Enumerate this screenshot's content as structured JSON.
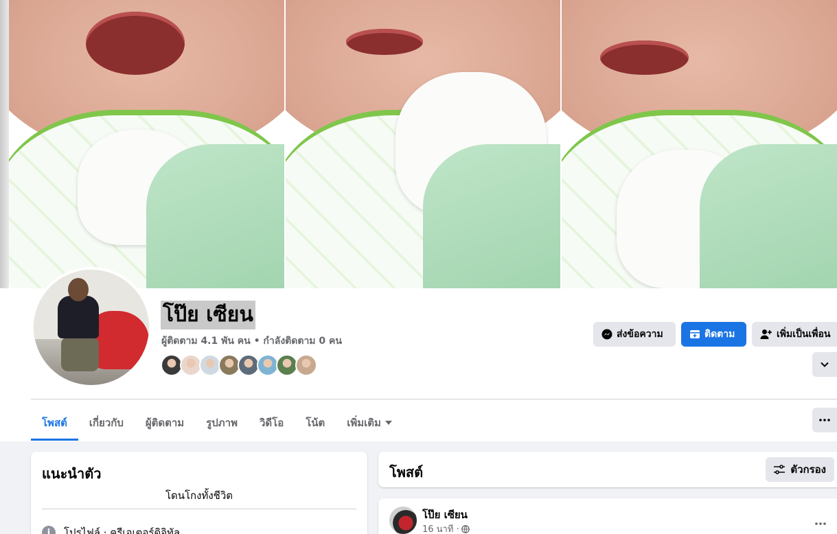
{
  "profile": {
    "name": "โป๊ย เซียน",
    "followers_line": "ผู้ติดตาม 4.1 พัน คน • กำลังติดตาม 0 คน"
  },
  "actions": {
    "message": "ส่งข้อความ",
    "follow": "ติดตาม",
    "add_friend": "เพิ่มเป็นเพื่อน"
  },
  "tabs": [
    {
      "label": "โพสต์"
    },
    {
      "label": "เกี่ยวกับ"
    },
    {
      "label": "ผู้ติดตาม"
    },
    {
      "label": "รูปภาพ"
    },
    {
      "label": "วิดีโอ"
    },
    {
      "label": "โน้ต"
    },
    {
      "label": "เพิ่มเติม"
    }
  ],
  "intro": {
    "title": "แนะนำตัว",
    "bio": "โดนโกงทั้งชีวิต",
    "profile_row": "โปรไฟล์ · ครีเอเตอร์ดิจิทัล"
  },
  "posts": {
    "title": "โพสต์",
    "filter": "ตัวกรอง",
    "first_post": {
      "author": "โป๊ย เซียน",
      "time": "16 นาที ·"
    }
  },
  "colors": {
    "accent": "#1b74e4",
    "button_grey": "#e4e6eb",
    "page_bg": "#f0f2f5"
  },
  "friend_avatar_colors": [
    "#3a3a3a",
    "#e9d6cc",
    "#cfd9e2",
    "#8a7a5c",
    "#5d6b7a",
    "#7fb3d3",
    "#5b7f4e",
    "#c8a98e"
  ]
}
